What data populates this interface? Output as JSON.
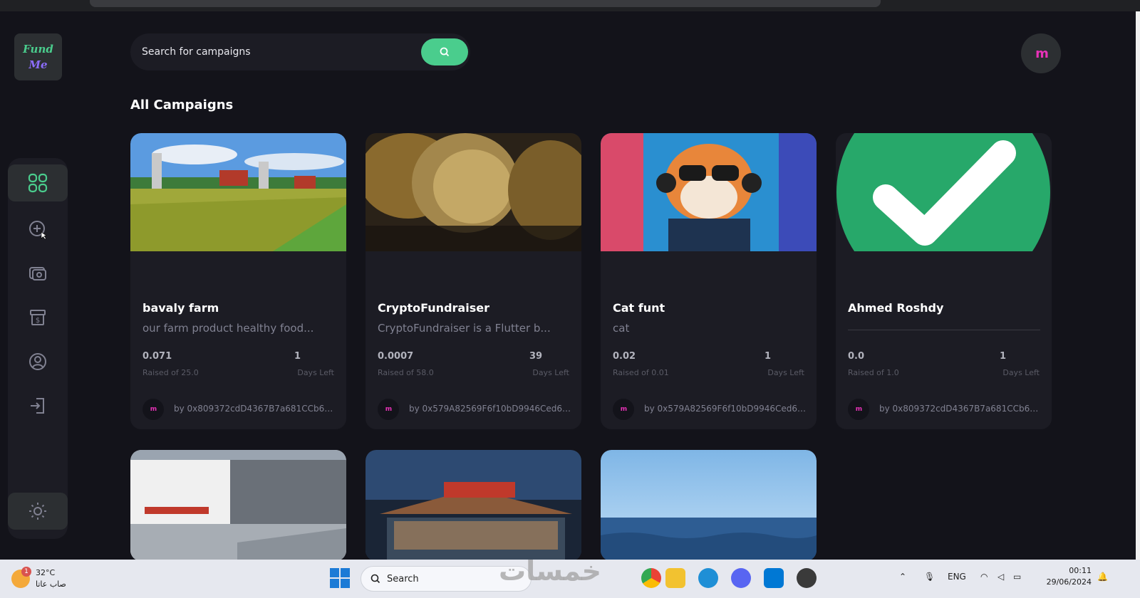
{
  "app": {
    "logo_line1": "Fund",
    "logo_line2": "Me",
    "avatar_text": "m"
  },
  "search": {
    "placeholder": "Search for campaigns"
  },
  "sidebar": {
    "items": [
      {
        "name": "dashboard",
        "icon": "dashboard-grid-icon"
      },
      {
        "name": "create-campaign",
        "icon": "add-circle-icon"
      },
      {
        "name": "payment",
        "icon": "payment-icon"
      },
      {
        "name": "withdraw",
        "icon": "withdraw-icon"
      },
      {
        "name": "profile",
        "icon": "profile-icon"
      },
      {
        "name": "logout",
        "icon": "logout-icon"
      }
    ],
    "theme_icon": "sun-icon"
  },
  "main": {
    "section_title": "All Campaigns",
    "campaigns": [
      {
        "title": "bavaly farm",
        "description": "our farm product healthy food...",
        "raised": "0.071",
        "raised_label": "Raised of 25.0",
        "days": "1",
        "days_label": "Days Left",
        "owner": "by 0x809372cdD4367B7a681CCb6A1..."
      },
      {
        "title": "CryptoFundraiser",
        "description": "CryptoFundraiser is a Flutter b...",
        "raised": "0.0007",
        "raised_label": "Raised of 58.0",
        "days": "39",
        "days_label": "Days Left",
        "owner": "by 0x579A82569F6f10bD9946Ced6A..."
      },
      {
        "title": "Cat funt",
        "description": "cat",
        "raised": "0.02",
        "raised_label": "Raised of 0.01",
        "days": "1",
        "days_label": "Days Left",
        "owner": "by 0x579A82569F6f10bD9946Ced6A..."
      },
      {
        "title": "Ahmed Roshdy",
        "description": "",
        "raised": "0.0",
        "raised_label": "Raised of 1.0",
        "days": "1",
        "days_label": "Days Left",
        "owner": "by 0x809372cdD4367B7a681CCb6A1..."
      }
    ]
  },
  "taskbar": {
    "weather_temp": "32°C",
    "weather_cond": "صاب عاتا",
    "weather_badge": "1",
    "search_label": "Search",
    "lang": "ENG",
    "time": "00:11",
    "date": "29/06/2024",
    "watermark": "خمسات"
  },
  "colors": {
    "accent_green": "#4acd8d",
    "accent_purple": "#8c6dfd",
    "bg": "#13131a",
    "card": "#1c1c24"
  }
}
